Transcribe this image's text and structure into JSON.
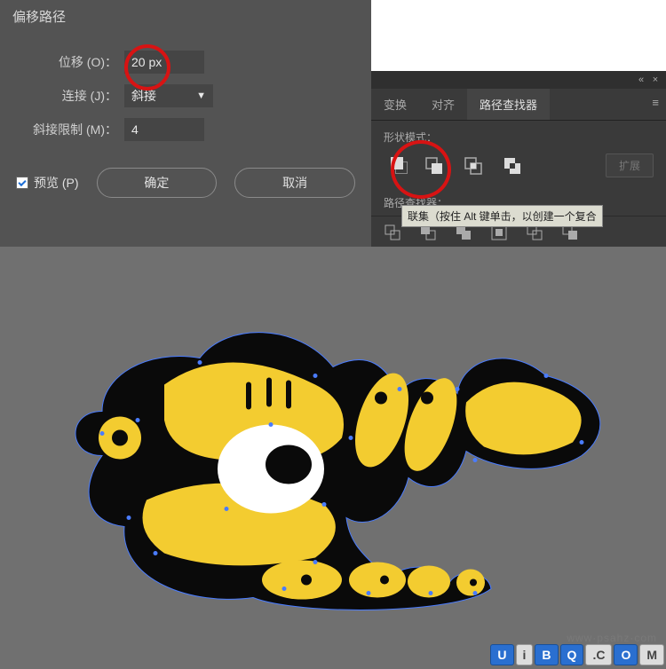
{
  "dialog": {
    "title": "偏移路径",
    "offset_label": "位移 (O)：",
    "offset_value": "20 px",
    "joins_label": "连接 (J)：",
    "joins_value": "斜接",
    "miter_label": "斜接限制 (M)：",
    "miter_value": "4",
    "preview_label": "预览 (P)",
    "ok": "确定",
    "cancel": "取消"
  },
  "panel": {
    "tabs": [
      "变换",
      "对齐",
      "路径查找器"
    ],
    "active_tab": 2,
    "shape_modes_label": "形状模式：",
    "expand": "扩展",
    "pathfinders_label": "路径查找器：",
    "tooltip": "联集（按住 Alt 键单击，以创建一个复合"
  },
  "watermark": {
    "u": "U",
    "i": "i",
    "b": "B",
    "q": "Q",
    "c": ".C",
    "o": "O",
    "m": "M",
    "faint": "www·psahz·com"
  }
}
